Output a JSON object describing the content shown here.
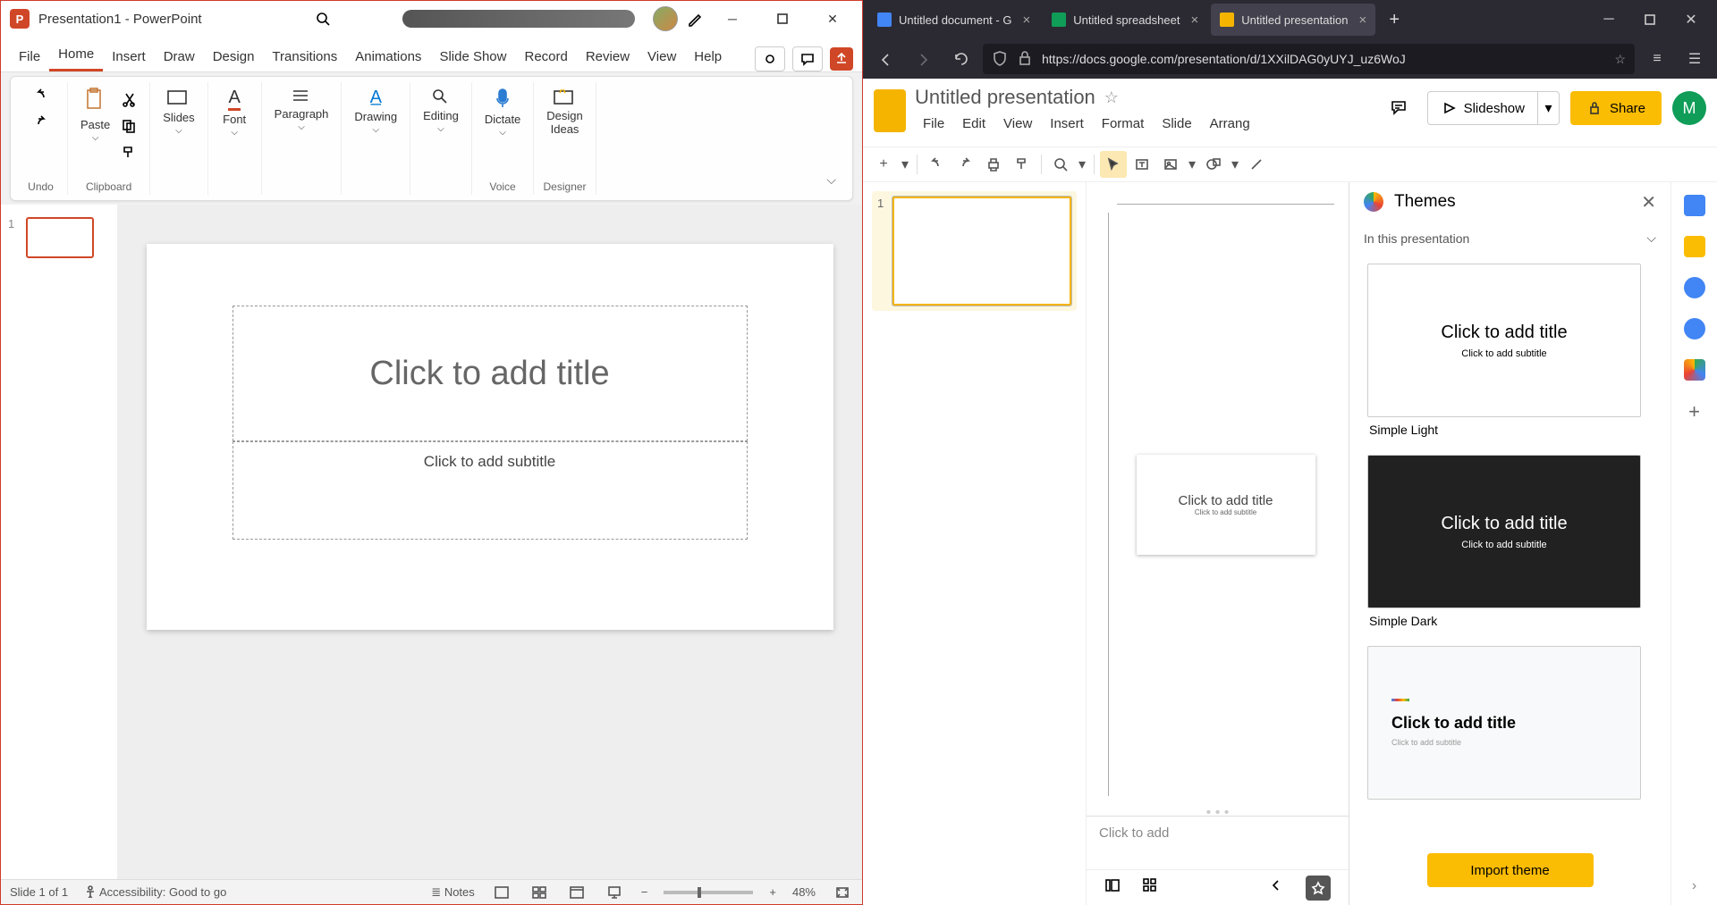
{
  "powerpoint": {
    "title": "Presentation1 - PowerPoint",
    "menu": [
      "File",
      "Home",
      "Insert",
      "Draw",
      "Design",
      "Transitions",
      "Animations",
      "Slide Show",
      "Record",
      "Review",
      "View",
      "Help"
    ],
    "active_menu": "Home",
    "ribbon": {
      "undo_label": "Undo",
      "paste_label": "Paste",
      "clipboard_group": "Clipboard",
      "slides_label": "Slides",
      "font_label": "Font",
      "paragraph_label": "Paragraph",
      "drawing_label": "Drawing",
      "editing_label": "Editing",
      "dictate_label": "Dictate",
      "voice_group": "Voice",
      "design_ideas_label": "Design\nIdeas",
      "designer_group": "Designer"
    },
    "thumb_num": "1",
    "slide": {
      "title_placeholder": "Click to add title",
      "subtitle_placeholder": "Click to add subtitle"
    },
    "status": {
      "slide_of": "Slide 1 of 1",
      "accessibility": "Accessibility: Good to go",
      "notes": "Notes",
      "zoom": "48%"
    }
  },
  "browser": {
    "tabs": [
      {
        "label": "Untitled document - G",
        "color": "#4285f4"
      },
      {
        "label": "Untitled spreadsheet",
        "color": "#0f9d58"
      },
      {
        "label": "Untitled presentation",
        "color": "#f4b400",
        "active": true
      }
    ],
    "url": "https://docs.google.com/presentation/d/1XXilDAG0yUYJ_uz6WoJ"
  },
  "gslides": {
    "doc_name": "Untitled presentation",
    "menus": [
      "File",
      "Edit",
      "View",
      "Insert",
      "Format",
      "Slide",
      "Arrang"
    ],
    "slideshow": "Slideshow",
    "share": "Share",
    "avatar_letter": "M",
    "filmstrip_num": "1",
    "slide": {
      "title": "Click to add title",
      "subtitle": "Click to add subtitle"
    },
    "speaker_notes_placeholder": "Click to add",
    "themes": {
      "header": "Themes",
      "in_presentation": "In this presentation",
      "list": [
        {
          "name": "Simple Light",
          "title": "Click to add title",
          "sub": "Click to add subtitle",
          "variant": "light"
        },
        {
          "name": "Simple Dark",
          "title": "Click to add title",
          "sub": "Click to add subtitle",
          "variant": "dark"
        },
        {
          "name": "",
          "title": "Click to add title",
          "sub": "Click to add subtitle",
          "variant": "streamline"
        }
      ],
      "import": "Import theme"
    }
  }
}
